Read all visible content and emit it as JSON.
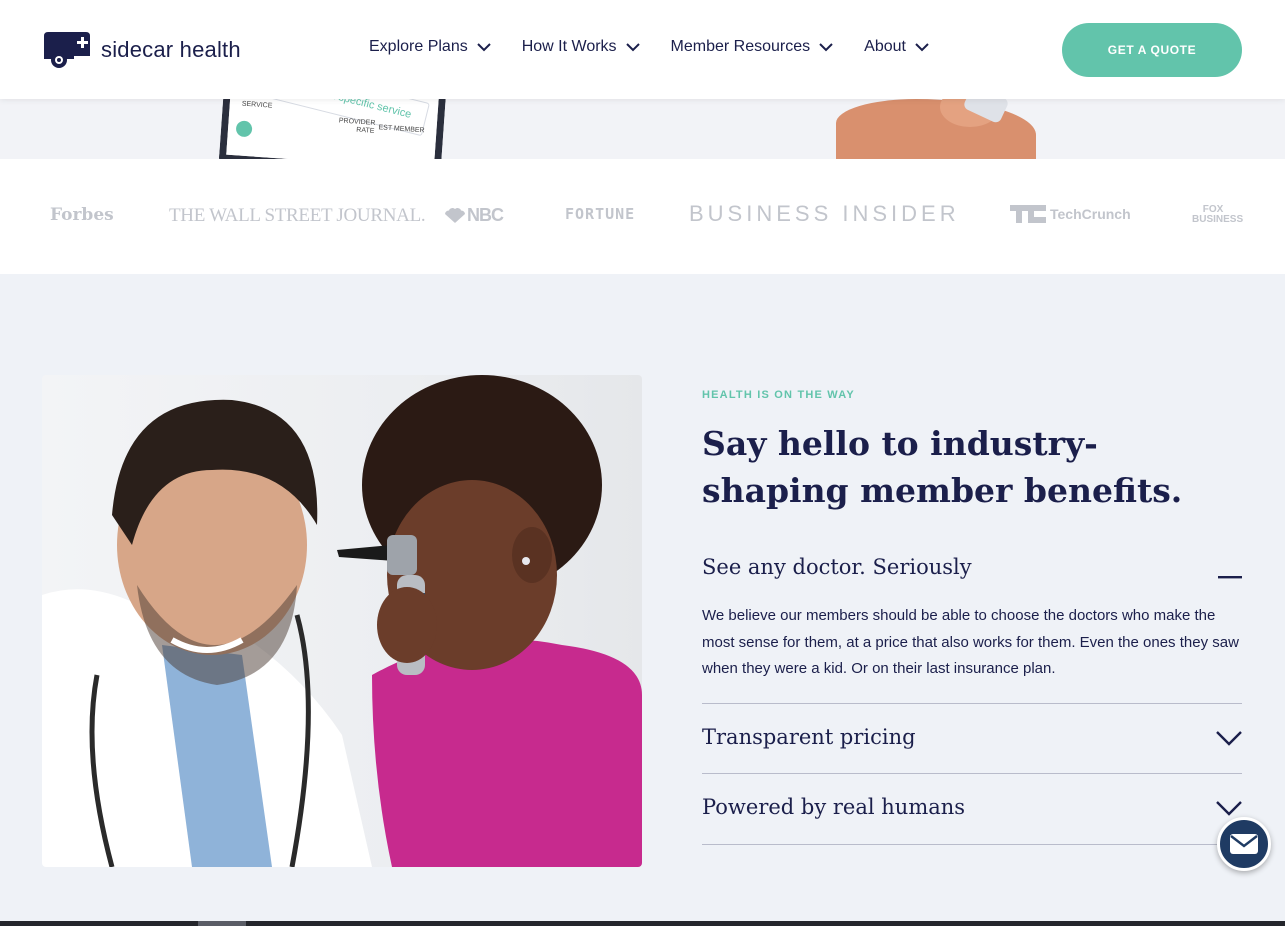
{
  "brand": {
    "name": "sidecar health",
    "accent": "#62c4ab",
    "navy": "#1b1f4b"
  },
  "nav": {
    "items": [
      {
        "label": "Explore Plans"
      },
      {
        "label": "How It Works"
      },
      {
        "label": "Member Resources"
      },
      {
        "label": "About"
      }
    ],
    "cta_label": "GET A QUOTE"
  },
  "hero": {
    "search_placeholder": "Search for a specific service",
    "phone_labels": [
      "SERVICE",
      "PROVIDER",
      "EST MEMBER",
      "RATE"
    ]
  },
  "press": {
    "logos": [
      "Forbes",
      "THE WALL STREET JOURNAL.",
      "NBC",
      "FORTUNE",
      "BUSINESS INSIDER",
      "TechCrunch",
      "FOX BUSINESS"
    ]
  },
  "benefits": {
    "eyebrow": "HEALTH IS ON THE WAY",
    "headline": "Say hello to industry-shaping member benefits.",
    "items": [
      {
        "title": "See any doctor. Seriously",
        "expanded": true,
        "body": "We believe our members should be able to choose the doctors who make the most sense for them, at a price that also works for them. Even the ones they saw when they were a kid. Or on their last insurance plan."
      },
      {
        "title": "Transparent pricing",
        "expanded": false
      },
      {
        "title": "Powered by real humans",
        "expanded": false
      }
    ]
  },
  "icons": {
    "logo": "ambulance-cross-icon",
    "nav_chevron": "chevron-down-icon",
    "collapse": "minus-icon",
    "expand": "chevron-down-icon",
    "chat": "envelope-icon"
  }
}
